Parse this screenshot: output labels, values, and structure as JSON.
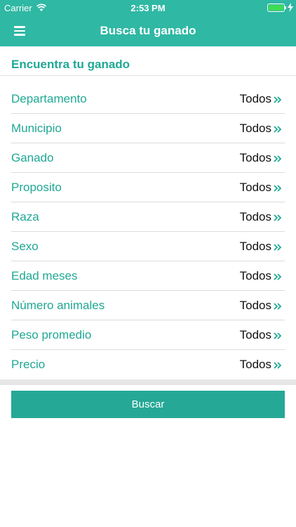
{
  "status_bar": {
    "carrier": "Carrier",
    "time": "2:53 PM"
  },
  "navbar": {
    "title": "Busca tu ganado",
    "menu_icon": "hamburger-menu-icon"
  },
  "section": {
    "title": "Encuentra tu ganado"
  },
  "filters": [
    {
      "label": "Departamento",
      "value": "Todos"
    },
    {
      "label": "Municipio",
      "value": "Todos"
    },
    {
      "label": "Ganado",
      "value": "Todos"
    },
    {
      "label": "Proposito",
      "value": "Todos"
    },
    {
      "label": "Raza",
      "value": "Todos"
    },
    {
      "label": "Sexo",
      "value": "Todos"
    },
    {
      "label": "Edad meses",
      "value": "Todos"
    },
    {
      "label": "Número animales",
      "value": "Todos"
    },
    {
      "label": "Peso promedio",
      "value": "Todos"
    },
    {
      "label": "Precio",
      "value": "Todos"
    }
  ],
  "search_button": {
    "label": "Buscar"
  },
  "colors": {
    "accent": "#2fb8a4",
    "label_text": "#1fa894",
    "button": "#26a896"
  }
}
